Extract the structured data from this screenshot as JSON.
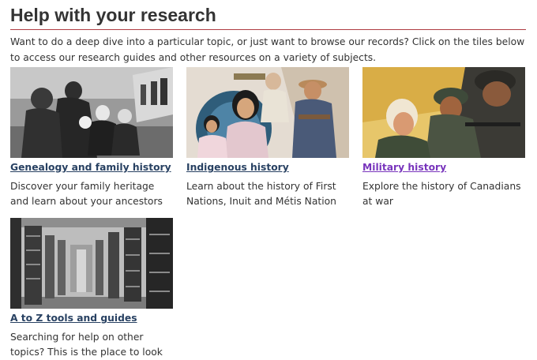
{
  "page": {
    "title": "Help with your research",
    "intro": "Want to do a deep dive into a particular topic, or just want to browse our records? Click on the tiles below to access our research guides and other resources on a variety of subjects."
  },
  "colors": {
    "accent_rule": "#af3c43",
    "link": "#284162",
    "link_visited": "#7834bc",
    "text": "#333333"
  },
  "tiles": [
    {
      "image": "family-group-photo",
      "link": "Genealogy and family history",
      "description": "Discover your family heritage and learn about your ancestors",
      "visited": false
    },
    {
      "image": "indigenous-portraits-collage",
      "link": "Indigenous history",
      "description": "Learn about the history of First Nations, Inuit and Métis Nation",
      "visited": false
    },
    {
      "image": "military-poster-illustration",
      "link": "Military history",
      "description": "Explore the history of Canadians at war",
      "visited": true
    },
    {
      "image": "library-stacks-photo",
      "link": "A to Z tools and guides",
      "description": "Searching for help on other topics? This is the place to look",
      "visited": false
    }
  ]
}
